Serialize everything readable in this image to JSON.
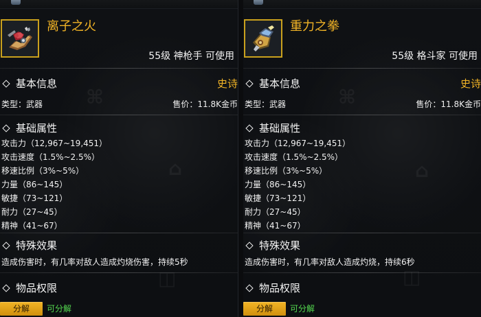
{
  "cards": [
    {
      "name": "离子之火",
      "level_text": "55级 神枪手 可使用",
      "rarity": "史诗",
      "type_text": "类型：武器",
      "price_text": "售价：11.8K金币",
      "sections": {
        "basic": "基本信息",
        "attributes": "基础属性",
        "effect": "特殊效果",
        "permissions": "物品权限"
      },
      "stats": [
        "攻击力（12,967~19,451）",
        "攻击速度（1.5%~2.5%）",
        "移速比例（3%~5%）",
        "力量（86~145）",
        "敏捷（73~121）",
        "耐力（27~45）",
        "精神（41~67）"
      ],
      "effect_text": "造成伤害时，有几率对敌人造成灼烧伤害，持续5秒",
      "decompose": {
        "button": "分解",
        "status": "可分解"
      }
    },
    {
      "name": "重力之拳",
      "level_text": "55级 格斗家 可使用",
      "rarity": "史诗",
      "type_text": "类型：武器",
      "price_text": "售价：11.8K金币",
      "sections": {
        "basic": "基本信息",
        "attributes": "基础属性",
        "effect": "特殊效果",
        "permissions": "物品权限"
      },
      "stats": [
        "攻击力（12,967~19,451）",
        "攻击速度（1.5%~2.5%）",
        "移速比例（3%~5%）",
        "力量（86~145）",
        "敏捷（73~121）",
        "耐力（27~45）",
        "精神（41~67）"
      ],
      "effect_text": "造成伤害时，有几率对敌人造成灼烧，持续6秒",
      "decompose": {
        "button": "分解",
        "status": "可分解"
      }
    }
  ],
  "colors": {
    "gold": "#f2b426",
    "green": "#54d84f",
    "text": "#f1f1f1"
  },
  "icons": {
    "left_item": "ion-fire-gauntlet-icon",
    "right_item": "gravity-fist-icon",
    "section": "diamond-icon"
  }
}
